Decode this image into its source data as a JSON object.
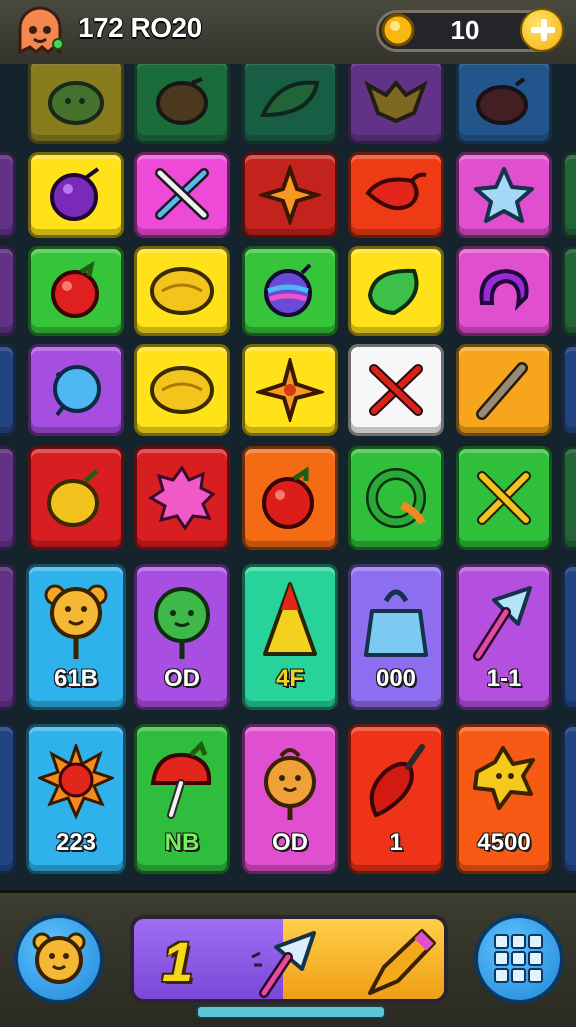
{
  "header": {
    "player_label": "172 RO20",
    "coins": "10",
    "avatar_icon": "ghost-mascot-icon",
    "coin_icon": "gold-coin-icon",
    "add_button_icon": "plus-icon"
  },
  "board": {
    "rows": [
      {
        "tiles": [
          {
            "color": "#e8c514",
            "icon": "leaf-blob-icon"
          },
          {
            "color": "#1fa846",
            "icon": "acorn-icon"
          },
          {
            "color": "#1b8f57",
            "icon": "leaf-icon"
          },
          {
            "color": "#a23fd1",
            "icon": "bat-icon"
          },
          {
            "color": "#2e7fd8",
            "icon": "eggplant-icon"
          }
        ]
      },
      {
        "tiles": [
          {
            "color": "#ffe21a",
            "icon": "plum-icon"
          },
          {
            "color": "#ee4ad8",
            "icon": "crossed-swords-icon"
          },
          {
            "color": "#c3231c",
            "icon": "star-burst-icon"
          },
          {
            "color": "#ee3a15",
            "icon": "chili-pepper-icon"
          },
          {
            "color": "#e04fcf",
            "icon": "star-icon"
          }
        ]
      },
      {
        "tiles": [
          {
            "color": "#36c43a",
            "icon": "tomato-icon"
          },
          {
            "color": "#ffe21a",
            "icon": "lemon-icon"
          },
          {
            "color": "#36c43a",
            "icon": "spinning-top-icon"
          },
          {
            "color": "#ffe21a",
            "icon": "lime-icon"
          },
          {
            "color": "#e04fcf",
            "icon": "ring-icon"
          }
        ]
      },
      {
        "tiles": [
          {
            "color": "#a64ee0",
            "icon": "balloon-icon"
          },
          {
            "color": "#ffe21a",
            "icon": "lemon-icon"
          },
          {
            "color": "#ffe21a",
            "icon": "shuriken-icon"
          },
          {
            "color": "#f7f7f7",
            "icon": "crossed-bones-icon"
          },
          {
            "color": "#f7a51c",
            "icon": "crayon-icon"
          }
        ]
      },
      {
        "tiles": [
          {
            "color": "#d91e22",
            "icon": "onion-icon"
          },
          {
            "color": "#d91e22",
            "icon": "splat-icon"
          },
          {
            "color": "#f56b14",
            "icon": "apple-icon"
          },
          {
            "color": "#2fbf3a",
            "icon": "knot-icon"
          },
          {
            "color": "#2fbf3a",
            "icon": "crossed-tools-icon"
          }
        ]
      }
    ],
    "cards": [
      {
        "cards": [
          {
            "color": "#2fb2ec",
            "icon": "bear-lollipop-icon",
            "label": "61B"
          },
          {
            "color": "#a84fe2",
            "icon": "green-monster-icon",
            "label": "OD"
          },
          {
            "color": "#27d39a",
            "icon": "cone-icon",
            "label": "4F"
          },
          {
            "color": "#8e6ef0",
            "icon": "bag-icon",
            "label": "000"
          },
          {
            "color": "#b44fe0",
            "icon": "hammer-icon",
            "label": "1-1"
          }
        ]
      },
      {
        "cards": [
          {
            "color": "#2fb2ec",
            "icon": "sun-icon",
            "label": "223"
          },
          {
            "color": "#2fbd3e",
            "icon": "mushroom-icon",
            "label": "NB"
          },
          {
            "color": "#e04fcf",
            "icon": "cookie-bear-icon",
            "label": "OD"
          },
          {
            "color": "#ee3318",
            "icon": "pepper-icon",
            "label": "1"
          },
          {
            "color": "#f65a14",
            "icon": "scarecrow-icon",
            "label": "4500"
          }
        ]
      }
    ]
  },
  "footer": {
    "character_button_icon": "teddy-bear-icon",
    "menu_button_icon": "grid-menu-icon",
    "progress_number": "1",
    "progress_fraction": 0.48,
    "progress_icons": [
      "hammer-icon",
      "pencil-icon"
    ]
  }
}
